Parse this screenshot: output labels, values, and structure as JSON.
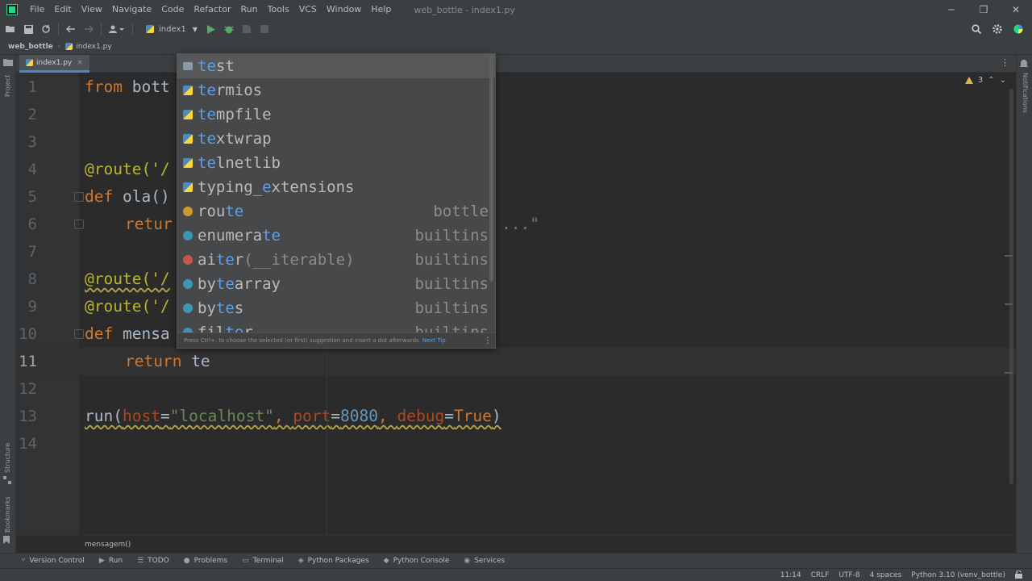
{
  "window": {
    "title": "web_bottle - index1.py",
    "menu": [
      "File",
      "Edit",
      "View",
      "Navigate",
      "Code",
      "Refactor",
      "Run",
      "Tools",
      "VCS",
      "Window",
      "Help"
    ],
    "controls": {
      "minimize": "─",
      "restore": "❐",
      "close": "✕"
    }
  },
  "toolbar": {
    "run_config": "index1",
    "icons": [
      "open-icon",
      "save-icon",
      "sync-icon",
      "back-icon",
      "forward-icon",
      "vcs-icon",
      "run-icon",
      "debug-icon",
      "coverage-icon",
      "stop-icon",
      "search-icon",
      "settings-icon",
      "plugin-icon"
    ]
  },
  "navbar": {
    "project": "web_bottle",
    "file": "index1.py"
  },
  "left_stripe": {
    "top_label": "Project",
    "structure_label": "Structure",
    "bookmarks_label": "Bookmarks"
  },
  "right_stripe": {
    "label": "Notifications"
  },
  "tab": {
    "label": "index1.py",
    "close": "×"
  },
  "inspection": {
    "count": "3"
  },
  "editor": {
    "current_line": 11,
    "lines": [
      {
        "n": "1"
      },
      {
        "n": "2"
      },
      {
        "n": "3"
      },
      {
        "n": "4"
      },
      {
        "n": "5"
      },
      {
        "n": "6"
      },
      {
        "n": "7"
      },
      {
        "n": "8"
      },
      {
        "n": "9"
      },
      {
        "n": "10"
      },
      {
        "n": "11"
      },
      {
        "n": "12"
      },
      {
        "n": "13"
      },
      {
        "n": "14"
      }
    ],
    "code": {
      "l1_kw": "from",
      "l1_rest": " bott",
      "l4": "@route('/",
      "l5_kw": "def",
      "l5_rest": " ola()",
      "l6_kw": "retur",
      "l6_tail": "...\"",
      "l8": "@route('/",
      "l9": "@route('/",
      "l10_kw": "def",
      "l10_rest": " mensa",
      "l11_kw": "return",
      "l11_rest": " te",
      "l13_fn": "run(",
      "l13_p1": "host",
      "l13_eq1": "=",
      "l13_s1": "\"localhost\"",
      "l13_c1": ", ",
      "l13_p2": "port",
      "l13_eq2": "=",
      "l13_n": "8080",
      "l13_c2": ", ",
      "l13_p3": "debug",
      "l13_eq3": "=",
      "l13_kw": "True",
      "l13_close": ")"
    }
  },
  "completion": {
    "items": [
      {
        "icon": "module",
        "match": "te",
        "rest": "st",
        "sig": "",
        "source": ""
      },
      {
        "icon": "pymod",
        "match": "te",
        "rest": "rmios",
        "sig": "",
        "source": ""
      },
      {
        "icon": "pymod",
        "match": "te",
        "rest": "mpfile",
        "sig": "",
        "source": ""
      },
      {
        "icon": "pymod",
        "match": "te",
        "rest": "xtwrap",
        "sig": "",
        "source": ""
      },
      {
        "icon": "pymod",
        "match": "te",
        "rest": "lnetlib",
        "sig": "",
        "source": ""
      },
      {
        "icon": "pymod",
        "pre": "typing_",
        "match": "e",
        "rest": "xtensions",
        "sig": "",
        "source": ""
      },
      {
        "icon": "variable",
        "pre": "rou",
        "match": "te",
        "rest": "",
        "sig": "",
        "source": "bottle"
      },
      {
        "icon": "cls",
        "pre": "enumera",
        "match": "te",
        "rest": "",
        "sig": "",
        "source": "builtins"
      },
      {
        "icon": "func",
        "pre": "ai",
        "match": "te",
        "rest": "r",
        "sig": "(__iterable)",
        "source": "builtins"
      },
      {
        "icon": "cls",
        "pre": "by",
        "match": "te",
        "rest": "array",
        "sig": "",
        "source": "builtins"
      },
      {
        "icon": "cls",
        "pre": "by",
        "match": "te",
        "rest": "s",
        "sig": "",
        "source": "builtins"
      },
      {
        "icon": "cls",
        "pre": "fil",
        "match": "te",
        "rest": "r",
        "sig": "",
        "source": "builtins"
      }
    ],
    "footer_text": "Press Ctrl+. to choose the selected (or first) suggestion and insert a dot afterwards",
    "footer_link": "Next Tip"
  },
  "editor_breadcrumb": "mensagem()",
  "tool_windows": [
    {
      "glyph": "⑂",
      "label": "Version Control"
    },
    {
      "glyph": "▶",
      "label": "Run"
    },
    {
      "glyph": "☰",
      "label": "TODO"
    },
    {
      "glyph": "●",
      "label": "Problems"
    },
    {
      "glyph": "▭",
      "label": "Terminal"
    },
    {
      "glyph": "◈",
      "label": "Python Packages"
    },
    {
      "glyph": "◆",
      "label": "Python Console"
    },
    {
      "glyph": "◉",
      "label": "Services"
    }
  ],
  "status": {
    "position": "11:14",
    "line_sep": "CRLF",
    "encoding": "UTF-8",
    "indent": "4 spaces",
    "interpreter": "Python 3.10 (venv_bottle)"
  }
}
